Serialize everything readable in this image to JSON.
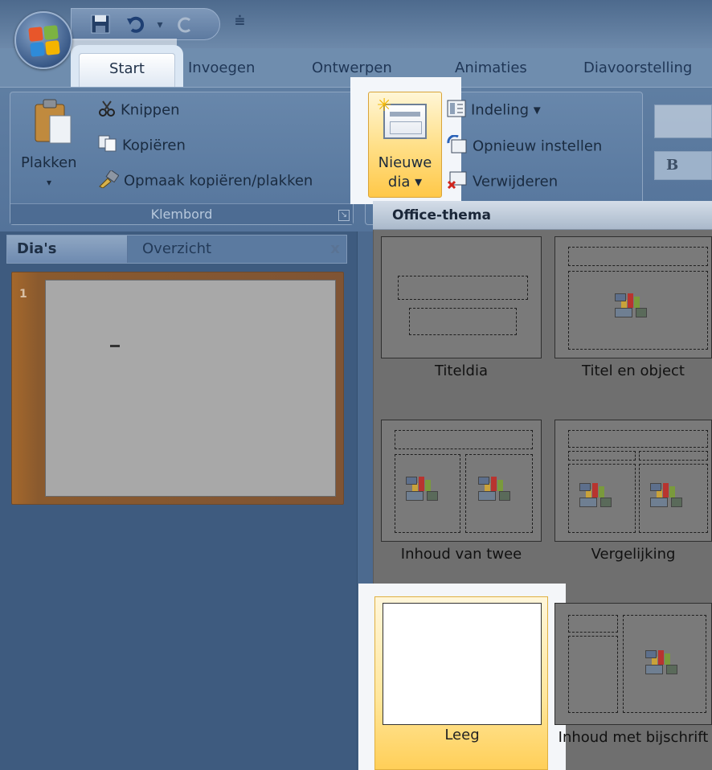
{
  "quick_access": {
    "save_icon": "save-icon",
    "undo_icon": "undo-icon",
    "redo_icon": "redo-icon",
    "customize_icon": "customize-icon"
  },
  "tabs": [
    {
      "label": "Start"
    },
    {
      "label": "Invoegen"
    },
    {
      "label": "Ontwerpen"
    },
    {
      "label": "Animaties"
    },
    {
      "label": "Diavoorstelling"
    }
  ],
  "clipboard": {
    "paste_label": "Plakken",
    "cut_label": "Knippen",
    "copy_label": "Kopiëren",
    "format_painter_label": "Opmaak kopiëren/plakken",
    "group_label": "Klembord"
  },
  "slides": {
    "new_slide_line1": "Nieuwe",
    "new_slide_line2": "dia ▾",
    "layout_label": "Indeling ▾",
    "reset_label": "Opnieuw instellen",
    "delete_label": "Verwijderen"
  },
  "font": {
    "bold_label": "B"
  },
  "pane": {
    "tab_slides": "Dia's",
    "tab_outline": "Overzicht",
    "close": "x",
    "thumb_number": "1"
  },
  "gallery": {
    "heading": "Office-thema",
    "layouts": [
      {
        "label": "Titeldia"
      },
      {
        "label": "Titel en object"
      },
      {
        "label": "Inhoud van twee"
      },
      {
        "label": "Vergelijking"
      },
      {
        "label": "Leeg"
      },
      {
        "label": "Inhoud met bijschrift"
      }
    ]
  },
  "colors": {
    "ribbon": "#5f7ea2",
    "highlight": "#ffe08a",
    "gallery_bg": "#6f6f6f"
  }
}
